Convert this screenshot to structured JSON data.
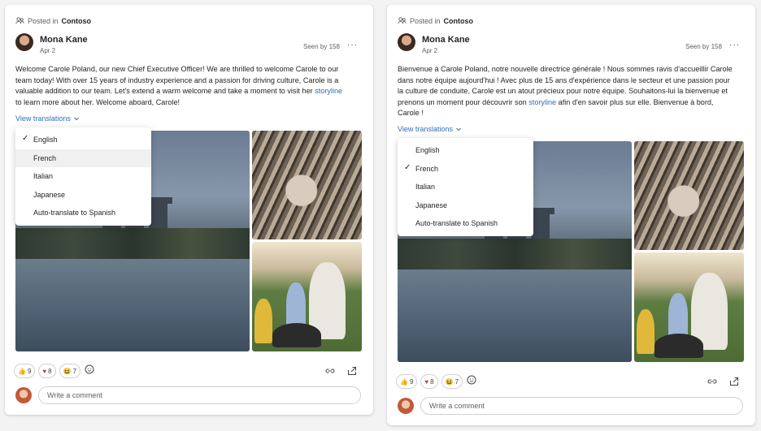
{
  "colors": {
    "link": "#2f6fb7",
    "text": "#242424",
    "muted": "#616161"
  },
  "posts": [
    {
      "posted_prefix": "Posted in",
      "community": "Contoso",
      "author": "Mona Kane",
      "date": "Apr 2",
      "seen": "Seen by 158",
      "more": "···",
      "body_lines": [
        "Welcome Carole Poland, our new Chief Executive Officer! We are thrilled to welcome Carole to our",
        "team today! With over 15 years of industry experience and a passion for driving culture, Carole is a",
        "valuable addition to our team. Let's extend a warm welcome and take a moment to visit her "
      ],
      "link": "storyline",
      "body_tail": "to learn more about her. Welcome aboard, Carole!",
      "view_translations": "View translations",
      "menu": [
        "English",
        "French",
        "Italian",
        "Japanese",
        "Auto-translate to Spanish"
      ],
      "selected_language": "English",
      "reactions": {
        "like": "9",
        "heart": "8",
        "laugh": "7"
      },
      "comment_placeholder": "Write a comment"
    },
    {
      "posted_prefix": "Posted in",
      "community": "Contoso",
      "author": "Mona Kane",
      "date": "Apr 2",
      "seen": "Seen by 158",
      "more": "···",
      "body_lines": [
        "Bienvenue à Carole Poland, notre nouvelle directrice générale ! Nous sommes ravis d'accueillir Carole",
        "dans notre équipe aujourd'hui ! Avec plus de 15 ans d'expérience dans le secteur et une passion pour",
        "la culture de conduite, Carole est un atout précieux pour notre équipe. Souhaitons-lui la bienvenue et",
        "prenons un moment pour découvrir son "
      ],
      "link": "storyline",
      "body_tail_inline": " afin d'en savoir plus sur elle. Bienvenue à bord,",
      "body_tail": "Carole !",
      "view_translations": "View translations",
      "menu": [
        "English",
        "French",
        "Italian",
        "Japanese",
        "Auto-translate to Spanish"
      ],
      "selected_language": "French",
      "reactions": {
        "like": "9",
        "heart": "8",
        "laugh": "7"
      },
      "comment_placeholder": "Write a comment"
    }
  ]
}
